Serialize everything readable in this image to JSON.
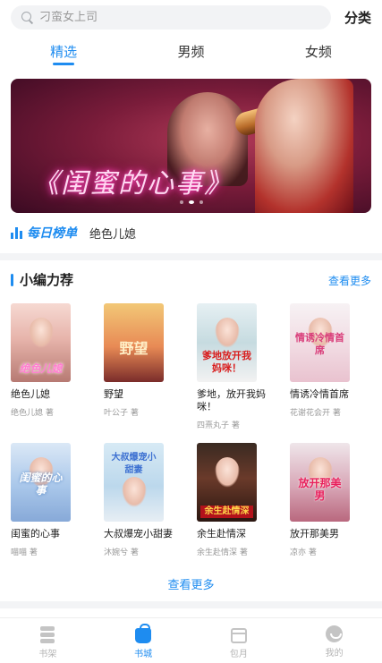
{
  "search": {
    "placeholder": "刁蛮女上司"
  },
  "header": {
    "category_label": "分类"
  },
  "tabs": [
    {
      "label": "精选",
      "active": true
    },
    {
      "label": "男频",
      "active": false
    },
    {
      "label": "女频",
      "active": false
    }
  ],
  "banner": {
    "title": "《闺蜜的心事》",
    "dot_count": 3,
    "active_dot": 1
  },
  "daily_rank": {
    "label": "每日榜单",
    "item": "绝色儿媳"
  },
  "section": {
    "title": "小编力荐",
    "more_label": "查看更多",
    "books": [
      {
        "name": "绝色儿媳",
        "author": "绝色儿媳 著",
        "cover_text": "绝色儿媳"
      },
      {
        "name": "野望",
        "author": "叶公子 著",
        "cover_text": "野望"
      },
      {
        "name": "爹地，放开我妈咪！",
        "author": "四熹丸子 著",
        "cover_text": "爹地放开我妈咪！"
      },
      {
        "name": "情诱冷情首席",
        "author": "花谢花会开 著",
        "cover_text": "情诱冷情首席"
      },
      {
        "name": "闺蜜的心事",
        "author": "喵喵 著",
        "cover_text": "闺蜜的心事"
      },
      {
        "name": "大叔爆宠小甜妻",
        "author": "沐婉兮 著",
        "cover_text": "大叔爆宠小甜妻"
      },
      {
        "name": "余生赴情深",
        "author": "余生赴情深 著",
        "cover_text": "余生赴情深"
      },
      {
        "name": "放开那美男",
        "author": "凉亦 著",
        "cover_text": "放开那美男"
      }
    ],
    "bottom_more_label": "查看更多"
  },
  "bottom_nav": [
    {
      "label": "书架",
      "icon": "bookshelf-icon",
      "active": false
    },
    {
      "label": "书城",
      "icon": "shopping-bag-icon",
      "active": true
    },
    {
      "label": "包月",
      "icon": "calendar-icon",
      "active": false
    },
    {
      "label": "我的",
      "icon": "profile-icon",
      "active": false
    }
  ],
  "colors": {
    "accent": "#1e8cf0",
    "muted": "#999999"
  }
}
